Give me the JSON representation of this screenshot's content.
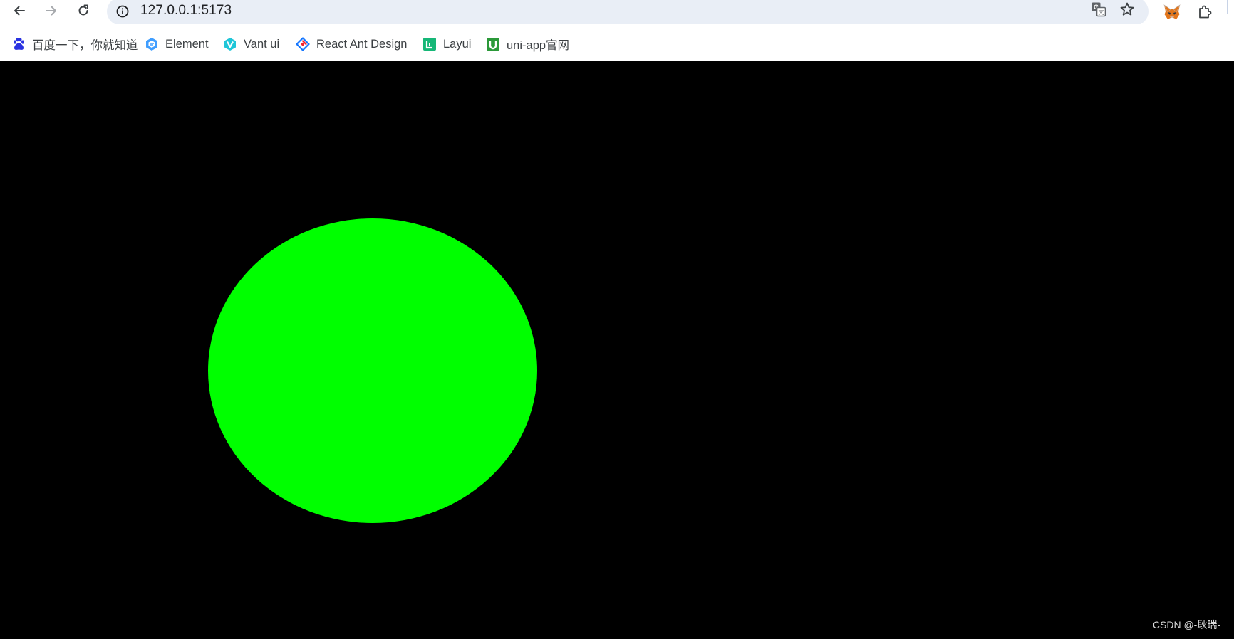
{
  "browser": {
    "url": "127.0.0.1:5173",
    "icons": {
      "back": "back-arrow-icon",
      "forward": "forward-arrow-icon",
      "reload": "reload-icon",
      "site_info": "info-icon",
      "translate": "translate-icon",
      "bookmark_star": "star-icon",
      "extension_fox": "metamask-fox-icon",
      "extensions": "puzzle-icon"
    }
  },
  "bookmarks": [
    {
      "label": "百度一下，你就知道",
      "icon": "baidu-paw-icon"
    },
    {
      "label": "Element",
      "icon": "element-icon"
    },
    {
      "label": "Vant ui",
      "icon": "vant-icon"
    },
    {
      "label": "React Ant Design",
      "icon": "ant-design-icon"
    },
    {
      "label": "Layui",
      "icon": "layui-icon"
    },
    {
      "label": "uni-app官网",
      "icon": "uniapp-icon"
    }
  ],
  "page": {
    "background_color": "#000000",
    "shape": {
      "kind": "circle",
      "color": "#00ff00"
    },
    "watermark": "CSDN @-耿瑞-"
  }
}
